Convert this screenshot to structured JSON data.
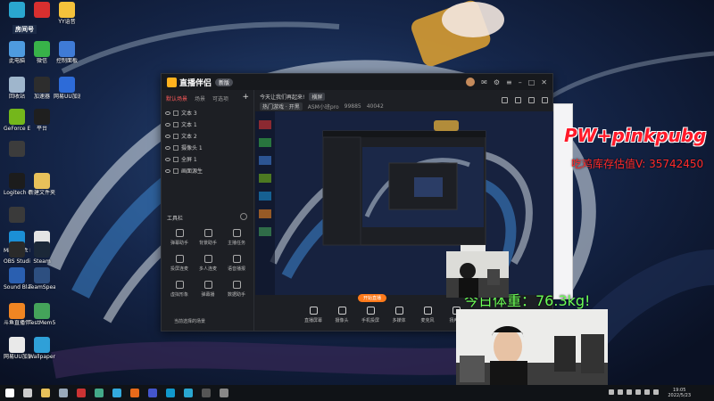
{
  "desktop": {
    "icons": [
      {
        "label": "",
        "name": "desktop-icon-player",
        "color": "#2aa7d0"
      },
      {
        "label": "",
        "name": "desktop-icon-netease",
        "color": "#d82f2f"
      },
      {
        "label": "YY语音",
        "name": "desktop-icon-yy",
        "color": "#f5c23b"
      },
      {
        "label": "此电脑",
        "name": "desktop-icon-computer",
        "color": "#4e9be0"
      },
      {
        "label": "微信",
        "name": "desktop-icon-wechat",
        "color": "#38b349"
      },
      {
        "label": "控制面板",
        "name": "desktop-icon-control-panel",
        "color": "#3f7bd6"
      },
      {
        "label": "回收站",
        "name": "desktop-icon-recycle-bin",
        "color": "#9fb6cc"
      },
      {
        "label": "加速器",
        "name": "desktop-icon-accelerator",
        "color": "#2d2d2d"
      },
      {
        "label": "网易UU加速器",
        "name": "desktop-icon-uu",
        "color": "#2d6bd8"
      },
      {
        "label": "GeForce Experience",
        "name": "desktop-icon-geforce",
        "color": "#74b71b"
      },
      {
        "label": "平台",
        "name": "desktop-icon-platform",
        "color": "#1f1f1f"
      },
      {
        "label": "",
        "name": "desktop-icon-misc1",
        "color": "#3c3c3c"
      },
      {
        "label": "Logitech G HUB",
        "name": "desktop-icon-ghub",
        "color": "#1c1c1c"
      },
      {
        "label": "新建文件夹",
        "name": "desktop-icon-new-folder",
        "color": "#e8c15a"
      },
      {
        "label": "",
        "name": "desktop-icon-misc2",
        "color": "#3a3a3a"
      },
      {
        "label": "Microsoft Edge",
        "name": "desktop-icon-edge",
        "color": "#1b8fd6"
      },
      {
        "label": "平台",
        "name": "desktop-icon-platform-2",
        "color": "#e4e4e4"
      },
      {
        "label": "OBS Studio",
        "name": "desktop-icon-obs",
        "color": "#2a2a2a"
      },
      {
        "label": "Steam",
        "name": "desktop-icon-steam",
        "color": "#1b2838"
      },
      {
        "label": "Sound Blaster",
        "name": "desktop-icon-sound-blaster",
        "color": "#2a5fb0"
      },
      {
        "label": "TeamSpeak",
        "name": "desktop-icon-teamspeak",
        "color": "#2d4f80"
      },
      {
        "label": "斗鱼直播伴侣",
        "name": "desktop-icon-douyu",
        "color": "#f08522"
      },
      {
        "label": "TestMem5",
        "name": "desktop-icon-testmem",
        "color": "#44a35a"
      },
      {
        "label": "网易UU加速器",
        "name": "desktop-icon-uu-2",
        "color": "#e9e9e9"
      },
      {
        "label": "Wallpaper Engine",
        "name": "desktop-icon-wallpaper-engine",
        "color": "#2fa0d8"
      }
    ],
    "room_label": "房间号"
  },
  "app": {
    "title": "直播伴侣",
    "version_badge": "新版",
    "left_tabs": [
      "默认场景",
      "场景",
      "可选项"
    ],
    "add_label": "+",
    "sources": [
      "文本 3",
      "文本 1",
      "文本 2",
      "摄像头 1",
      "全屏 1",
      "画面源生"
    ],
    "tools_header": "工具栏",
    "tools": [
      "弹幕助手",
      "背景助手",
      "主播任务",
      "投屏连麦",
      "多人连麦",
      "语音播报",
      "虚拟形象",
      "弹幕播",
      "数据助手"
    ],
    "bottom_note": "当前选择的场景",
    "top_line1": "今天让我们再起来!",
    "top_mode": "横屏",
    "top_tags": [
      "热门游戏 · 开黑",
      "ASM小班pro",
      "99885",
      "40042"
    ],
    "bottom_buttons": [
      "直播屏幕",
      "摄像头",
      "手机投屏",
      "多媒体",
      "麦克风",
      "扬声器"
    ],
    "go_live": "开始直播"
  },
  "overlay": {
    "pw_text": "PW+pinkpubg",
    "stock_text": "吃鸡库存估值V: 35742450",
    "weight_text": "今日体重：76.3kg!"
  },
  "taskbar": {
    "icons": [
      {
        "name": "start-icon",
        "color": "#ffffff"
      },
      {
        "name": "taskbar-search-icon",
        "color": "#cccccc"
      },
      {
        "name": "taskbar-app-explorer-icon",
        "color": "#e8c15a"
      },
      {
        "name": "taskbar-app-steam-icon",
        "color": "#9ab"
      },
      {
        "name": "taskbar-app-media-icon",
        "color": "#c33"
      },
      {
        "name": "taskbar-app-chat-icon",
        "color": "#4a8"
      },
      {
        "name": "taskbar-app-game-icon",
        "color": "#3ad"
      },
      {
        "name": "taskbar-app-g-icon",
        "color": "#e86a1a"
      },
      {
        "name": "taskbar-app-window-icon",
        "color": "#45c"
      },
      {
        "name": "taskbar-app-edge-icon",
        "color": "#19c"
      },
      {
        "name": "taskbar-app-live-icon",
        "color": "#2aa7d0"
      },
      {
        "name": "taskbar-app-obs-icon",
        "color": "#555"
      },
      {
        "name": "taskbar-app-misc-icon",
        "color": "#888"
      }
    ],
    "time": "19:05",
    "date": "2022/5/23"
  }
}
